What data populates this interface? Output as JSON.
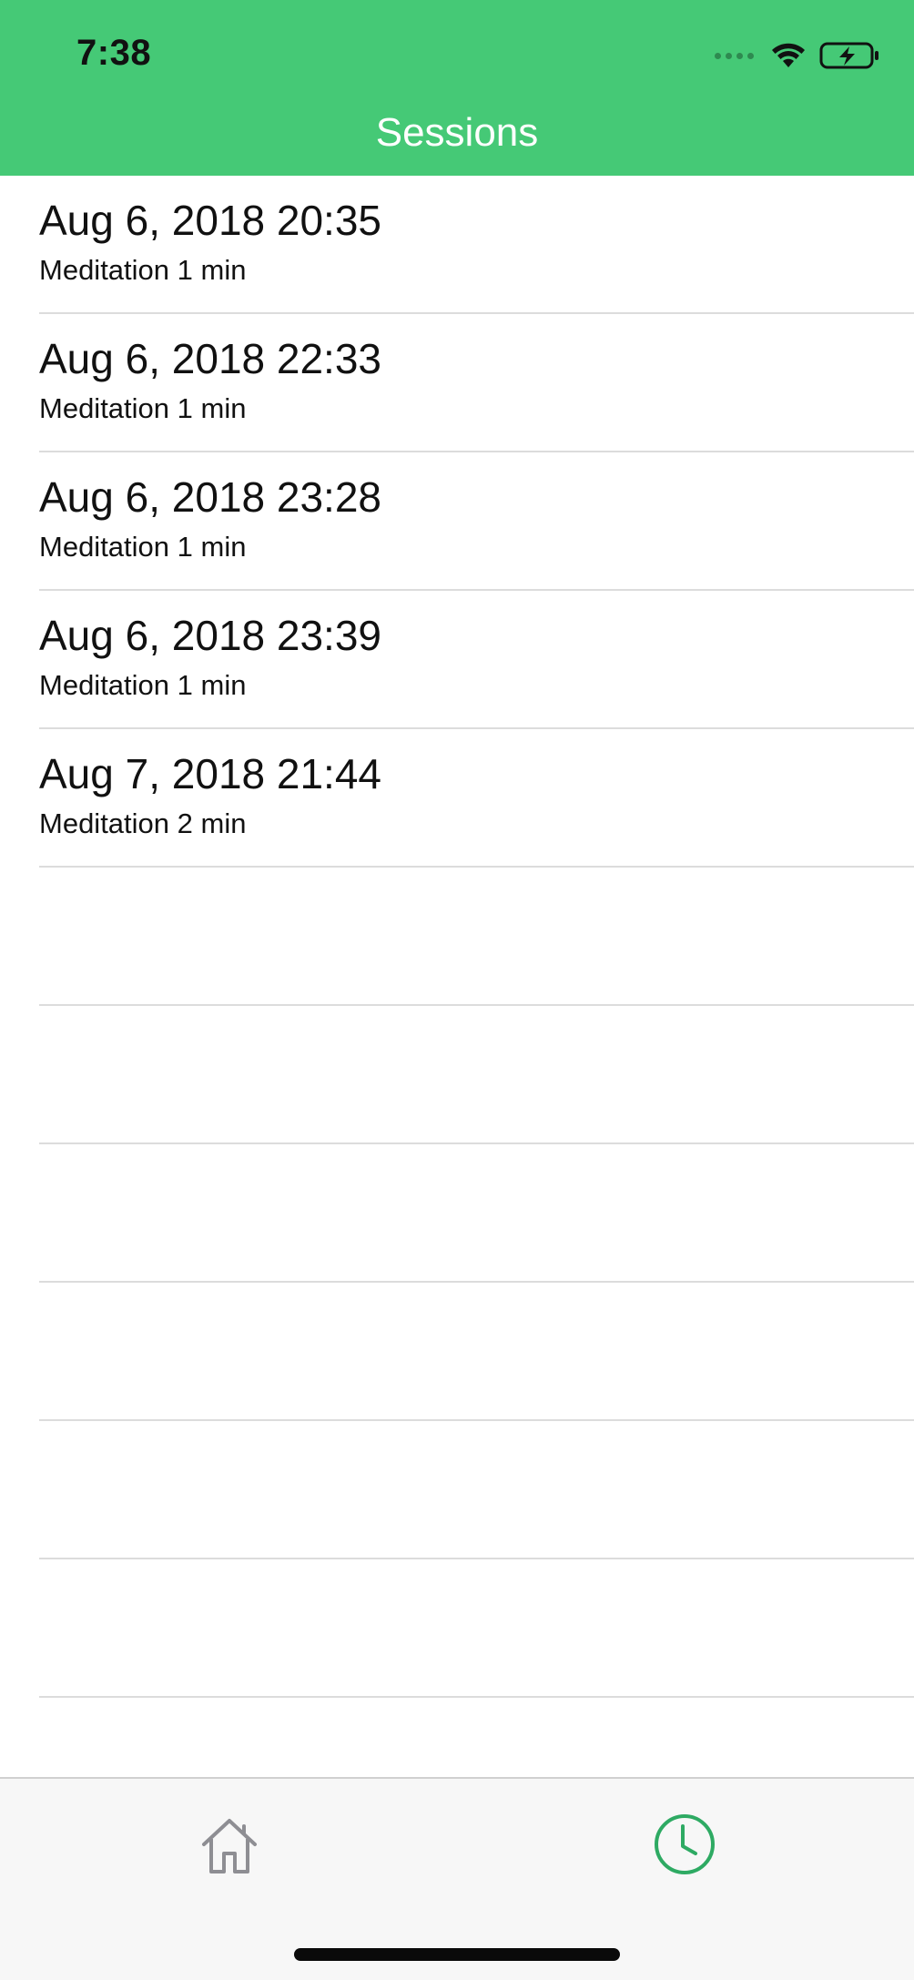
{
  "status_bar": {
    "time": "7:38"
  },
  "nav": {
    "title": "Sessions"
  },
  "sessions": [
    {
      "date": "Aug 6, 2018 20:35",
      "detail": "Meditation 1 min"
    },
    {
      "date": "Aug 6, 2018 22:33",
      "detail": "Meditation 1 min"
    },
    {
      "date": "Aug 6, 2018 23:28",
      "detail": "Meditation 1 min"
    },
    {
      "date": "Aug 6, 2018 23:39",
      "detail": "Meditation 1 min"
    },
    {
      "date": "Aug 7, 2018 21:44",
      "detail": "Meditation 2 min"
    }
  ],
  "tabs": [
    {
      "icon": "home-icon",
      "selected": false
    },
    {
      "icon": "clock-icon",
      "selected": true
    }
  ],
  "colors": {
    "header": "#45c976",
    "accent": "#2eaa63",
    "inactive_tab": "#8e8e93"
  }
}
